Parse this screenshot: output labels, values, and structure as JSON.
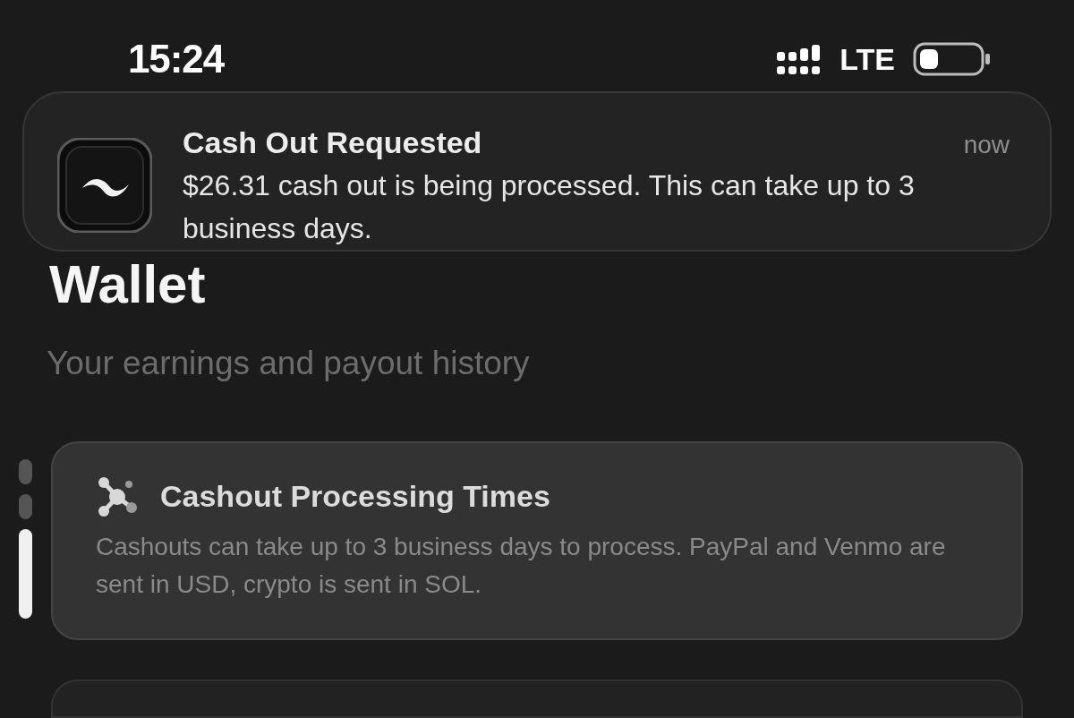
{
  "status_bar": {
    "time": "15:24",
    "network": "LTE"
  },
  "notification": {
    "title": "Cash Out Requested",
    "time": "now",
    "body": "$26.31 cash out is being processed. This can take up to 3 business days."
  },
  "header": {
    "title": "Wallet",
    "subtitle": "Your earnings and payout history"
  },
  "page_indicator": [
    {
      "selected": false
    },
    {
      "selected": false
    },
    {
      "selected": true
    }
  ],
  "info_card": {
    "title": "Cashout Processing Times",
    "body": "Cashouts can take up to 3 business days to process. PayPal and Venmo are sent in USD, crypto is sent in SOL."
  }
}
